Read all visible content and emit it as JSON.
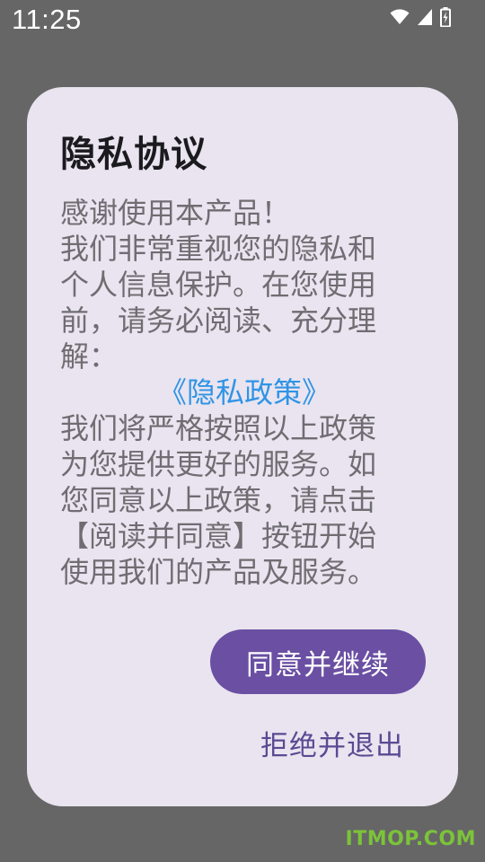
{
  "status_bar": {
    "time": "11:25",
    "icons": [
      "wifi-icon",
      "cell-signal-icon",
      "battery-charging-icon"
    ]
  },
  "dialog": {
    "title": "隐私协议",
    "body_lines_before": [
      "感谢使用本产品！",
      "我们非常重视您的隐私和",
      "个人信息保护。在您使用",
      "前，请务必阅读、充分理",
      "解："
    ],
    "policy_link": "《隐私政策》",
    "body_lines_after": [
      "我们将严格按照以上政策",
      "为您提供更好的服务。如",
      "您同意以上政策，请点击",
      "【阅读并同意】按钮开始",
      "使用我们的产品及服务。"
    ],
    "agree_button": "同意并继续",
    "exit_button": "拒绝并退出"
  },
  "watermark": "ITMOP.COM",
  "colors": {
    "background_overlay": "#666666",
    "dialog_background": "#e9e4ef",
    "link": "#2f94e6",
    "primary_button": "#6a4fa3",
    "text_button": "#5a4a93",
    "body_text": "#6f6d72"
  }
}
